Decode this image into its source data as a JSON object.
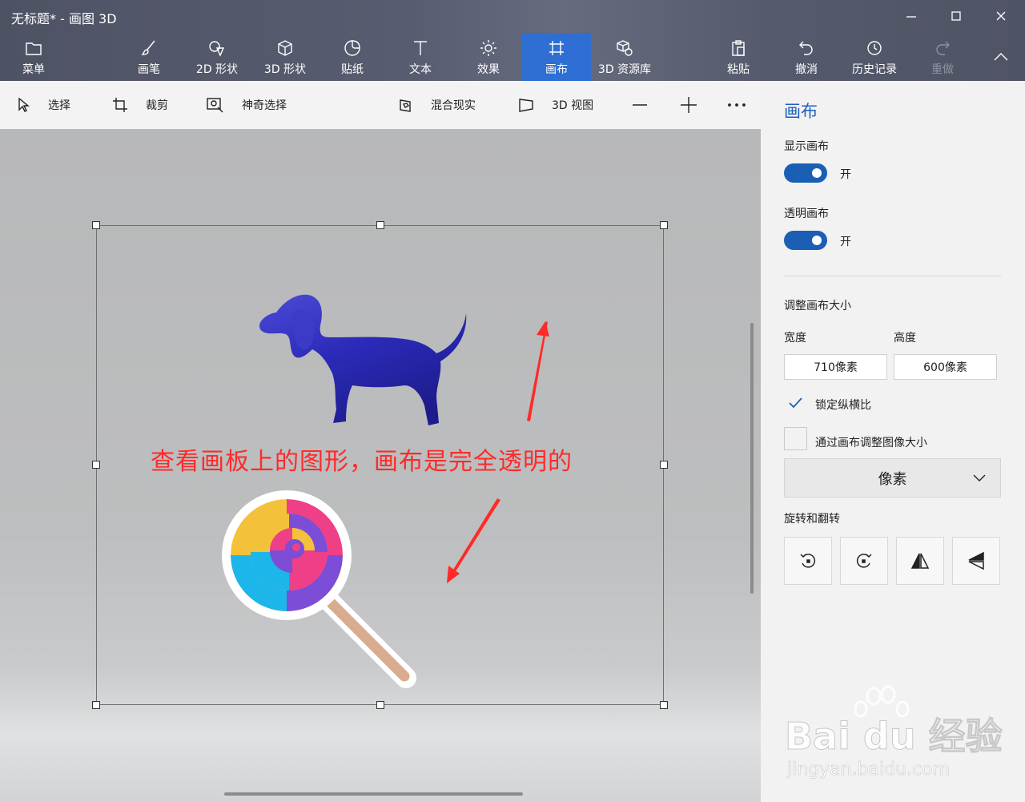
{
  "window": {
    "title": "无标题* - 画图 3D"
  },
  "ribbon": {
    "menu": "菜单",
    "brushes": "画笔",
    "shapes2d": "2D 形状",
    "shapes3d": "3D 形状",
    "stickers": "贴纸",
    "text": "文本",
    "effects": "效果",
    "canvas": "画布",
    "library": "3D 资源库",
    "paste": "粘贴",
    "undo": "撤消",
    "history": "历史记录",
    "redo": "重做"
  },
  "toolbar": {
    "select": "选择",
    "crop": "裁剪",
    "magic_select": "神奇选择",
    "mixed_reality": "混合现实",
    "view3d": "3D 视图"
  },
  "canvas": {
    "annotation": "查看画板上的图形，画布是完全透明的",
    "watermark_text": "Bai du 经验",
    "watermark_url": "jingyan.baidu.com"
  },
  "panel": {
    "title": "画布",
    "show_canvas_label": "显示画布",
    "show_canvas_state": "开",
    "transparent_label": "透明画布",
    "transparent_state": "开",
    "resize_label": "调整画布大小",
    "width_label": "宽度",
    "height_label": "高度",
    "width_value": "710像素",
    "height_value": "600像素",
    "lock_aspect": "锁定纵横比",
    "lock_aspect_checked": true,
    "resize_image": "通过画布调整图像大小",
    "resize_image_checked": false,
    "unit": "像素",
    "rotate_flip_label": "旋转和翻转"
  },
  "colors": {
    "accent": "#2f6fd3",
    "toggle_on": "#1a5fb4",
    "annotation": "#ff2a2a"
  }
}
